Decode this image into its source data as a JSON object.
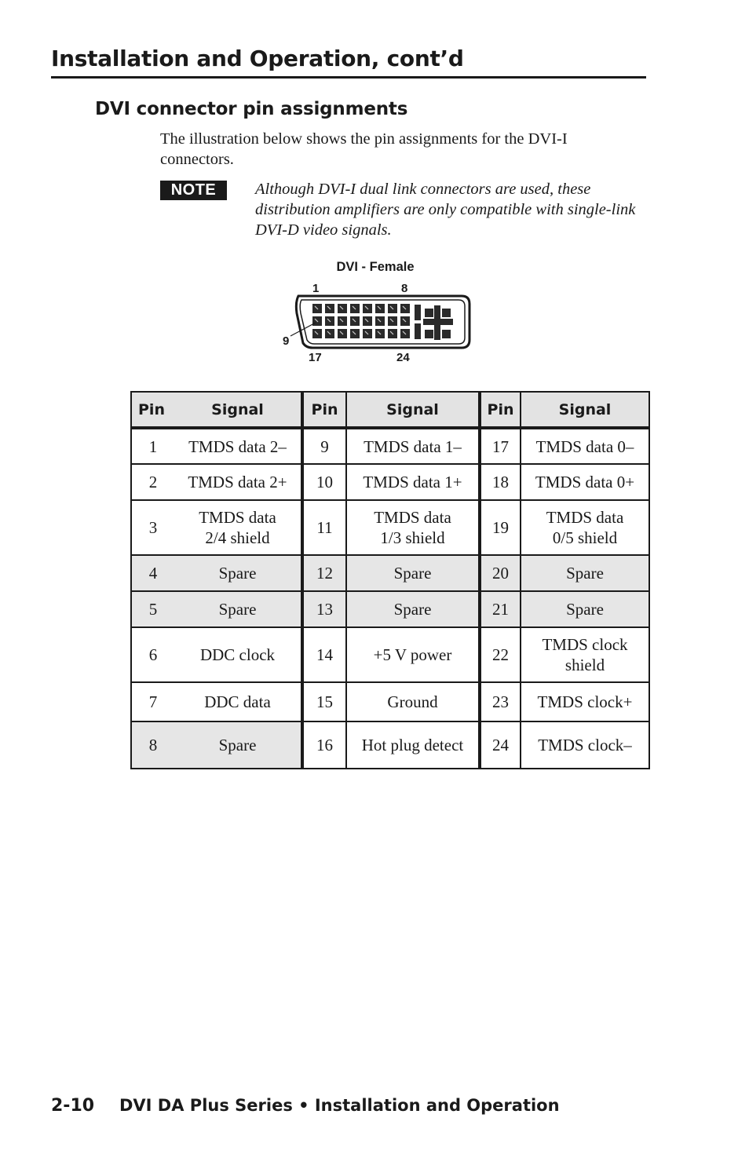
{
  "page": {
    "heading": "Installation and Operation, cont’d",
    "section_heading": "DVI connector pin assignments",
    "intro_text": "The illustration below shows the pin assignments for the DVI-I connectors.",
    "note": {
      "badge": "NOTE",
      "text": "Although DVI-I dual link connectors are used, these distribution amplifiers are only compatible with single-link DVI-D video signals."
    }
  },
  "diagram": {
    "title": "DVI - Female",
    "labels": {
      "top_left": "1",
      "top_right": "8",
      "left": "9",
      "bottom_left": "17",
      "bottom_right": "24"
    },
    "pin_rows": 3,
    "pins_per_row": 8
  },
  "table": {
    "headers": [
      "Pin",
      "Signal",
      "Pin",
      "Signal",
      "Pin",
      "Signal"
    ],
    "rows": [
      {
        "shaded": false,
        "cells": [
          "1",
          "TMDS data 2–",
          "9",
          "TMDS data 1–",
          "17",
          "TMDS data 0–"
        ]
      },
      {
        "shaded": false,
        "cells": [
          "2",
          "TMDS data 2+",
          "10",
          "TMDS data 1+",
          "18",
          "TMDS data 0+"
        ]
      },
      {
        "shaded": false,
        "cells": [
          "3",
          "TMDS data\n2/4 shield",
          "11",
          "TMDS data\n1/3 shield",
          "19",
          "TMDS data\n0/5 shield"
        ]
      },
      {
        "shaded": true,
        "cells": [
          "4",
          "Spare",
          "12",
          "Spare",
          "20",
          "Spare"
        ]
      },
      {
        "shaded": true,
        "cells": [
          "5",
          "Spare",
          "13",
          "Spare",
          "21",
          "Spare"
        ]
      },
      {
        "shaded": false,
        "cells": [
          "6",
          "DDC clock",
          "14",
          "+5 V power",
          "22",
          "TMDS clock\nshield"
        ]
      },
      {
        "shaded": false,
        "cells": [
          "7",
          "DDC data",
          "15",
          "Ground",
          "23",
          "TMDS clock+"
        ]
      },
      {
        "shaded": "first-pair",
        "cells": [
          "8",
          "Spare",
          "16",
          "Hot plug detect",
          "24",
          "TMDS clock–"
        ]
      }
    ]
  },
  "footer": {
    "page_number": "2-10",
    "title": "DVI DA Plus Series • Installation and Operation"
  }
}
